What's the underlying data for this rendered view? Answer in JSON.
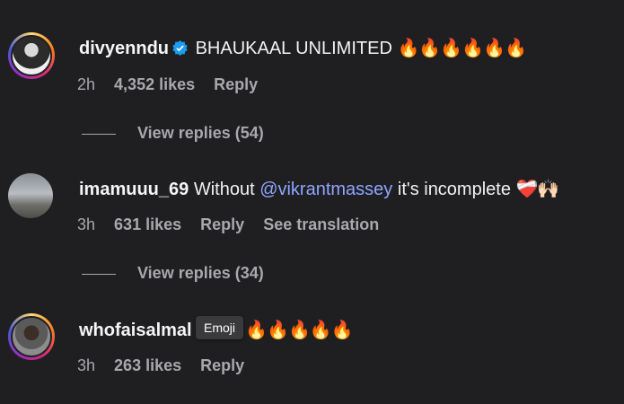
{
  "comments": [
    {
      "username": "divyenndu",
      "text": "BHAUKAAL UNLIMITED",
      "emoji": "🔥🔥🔥🔥🔥🔥",
      "time": "2h",
      "likes": "4,352 likes",
      "reply": "Reply",
      "view_replies": "View replies (54)"
    },
    {
      "username": "imamuuu_69",
      "text_before": "Without ",
      "mention": "@vikrantmassey",
      "text_after": " it's incomplete",
      "emoji": "❤️‍🩹🙌🏻",
      "time": "3h",
      "likes": "631 likes",
      "reply": "Reply",
      "translate": "See translation",
      "view_replies": "View replies (34)"
    },
    {
      "username": "whofaisalmal",
      "emoji": "🔥🔥🔥🔥🔥",
      "time": "3h",
      "likes": "263 likes",
      "reply": "Reply"
    }
  ],
  "tooltip": "Emoji",
  "colors": {
    "background": "#1f1f22",
    "muted": "#a8a8ad",
    "mention": "#8fa6ff",
    "verified": "#1d9bf0"
  }
}
